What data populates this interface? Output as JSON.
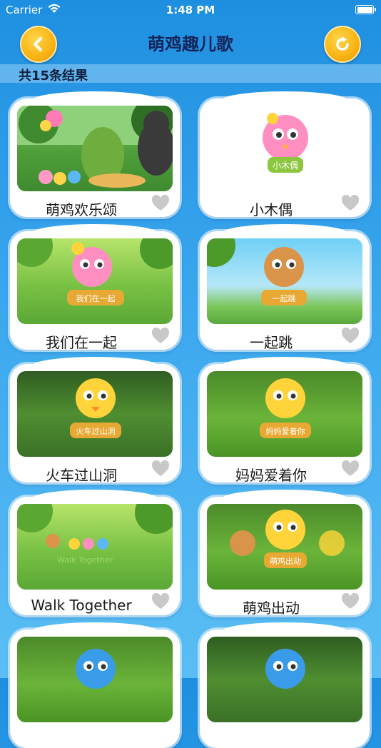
{
  "status": {
    "carrier": "Carrier",
    "time": "1:48 PM"
  },
  "nav": {
    "title": "萌鸡趣儿歌",
    "back_icon": "chevron-left-icon",
    "refresh_icon": "refresh-icon"
  },
  "result_count": "共15条结果",
  "colors": {
    "accent": "#f8b313",
    "background": "#3ba7ee",
    "heart": "#c8c8c8"
  },
  "cards": [
    {
      "title": "萌鸡欢乐颂",
      "thumb_text": ""
    },
    {
      "title": "小木偶",
      "thumb_text": "小木偶"
    },
    {
      "title": "我们在一起",
      "thumb_text": "我们在一起"
    },
    {
      "title": "一起跳",
      "thumb_text": "一起跳"
    },
    {
      "title": "火车过山洞",
      "thumb_text": "火车过山洞"
    },
    {
      "title": "妈妈爱着你",
      "thumb_text": "妈妈爱着你"
    },
    {
      "title": "Walk Together",
      "thumb_text": "Walk Together"
    },
    {
      "title": "萌鸡出动",
      "thumb_text": "萌鸡出动"
    },
    {
      "title": "",
      "thumb_text": ""
    },
    {
      "title": "",
      "thumb_text": ""
    }
  ]
}
